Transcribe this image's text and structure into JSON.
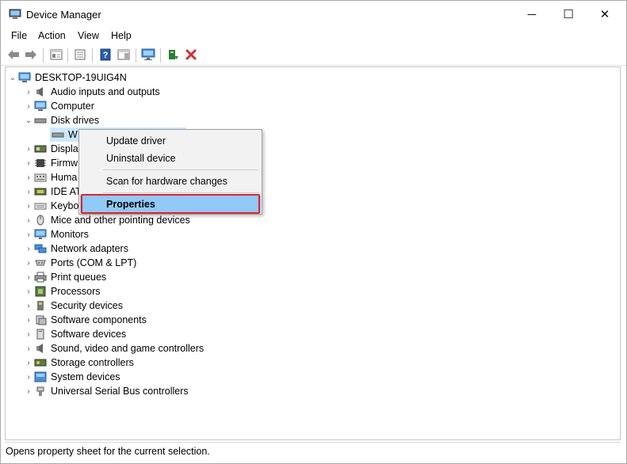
{
  "window": {
    "title": "Device Manager",
    "controls": {
      "minimize": "─",
      "maximize": "☐",
      "close": "✕"
    }
  },
  "menu": [
    "File",
    "Action",
    "View",
    "Help"
  ],
  "toolbar": {
    "buttons": [
      "back-icon",
      "forward-icon",
      "show-hide-tree-icon",
      "properties-icon",
      "help-icon",
      "action-pane-icon",
      "monitor-icon",
      "update-driver-icon",
      "uninstall-icon"
    ]
  },
  "tree": {
    "root": "DESKTOP-19UIG4N",
    "items": [
      {
        "label": "Audio inputs and outputs",
        "icon": "speaker-icon",
        "expanded": false
      },
      {
        "label": "Computer",
        "icon": "computer-icon",
        "expanded": false
      },
      {
        "label": "Disk drives",
        "icon": "disk-drive-icon",
        "expanded": true
      },
      {
        "label": "W",
        "icon": "disk-drive-icon",
        "child": true,
        "selected": true
      },
      {
        "label": "Displa",
        "icon": "display-adapter-icon",
        "expanded": false
      },
      {
        "label": "Firmw",
        "icon": "firmware-icon",
        "expanded": false
      },
      {
        "label": "Huma",
        "icon": "hid-icon",
        "expanded": false
      },
      {
        "label": "IDE AT",
        "icon": "ide-controller-icon",
        "expanded": false
      },
      {
        "label": "Keybo",
        "icon": "keyboard-icon",
        "expanded": false
      },
      {
        "label": "Mice and other pointing devices",
        "icon": "mouse-icon",
        "expanded": false
      },
      {
        "label": "Monitors",
        "icon": "monitor-icon",
        "expanded": false
      },
      {
        "label": "Network adapters",
        "icon": "network-icon",
        "expanded": false
      },
      {
        "label": "Ports (COM & LPT)",
        "icon": "port-icon",
        "expanded": false
      },
      {
        "label": "Print queues",
        "icon": "printer-icon",
        "expanded": false
      },
      {
        "label": "Processors",
        "icon": "processor-icon",
        "expanded": false
      },
      {
        "label": "Security devices",
        "icon": "security-icon",
        "expanded": false
      },
      {
        "label": "Software components",
        "icon": "software-component-icon",
        "expanded": false
      },
      {
        "label": "Software devices",
        "icon": "software-device-icon",
        "expanded": false
      },
      {
        "label": "Sound, video and game controllers",
        "icon": "speaker-icon",
        "expanded": false
      },
      {
        "label": "Storage controllers",
        "icon": "storage-controller-icon",
        "expanded": false
      },
      {
        "label": "System devices",
        "icon": "system-device-icon",
        "expanded": false
      },
      {
        "label": "Universal Serial Bus controllers",
        "icon": "usb-icon",
        "expanded": false
      }
    ]
  },
  "context_menu": {
    "update_driver": "Update driver",
    "uninstall_device": "Uninstall device",
    "scan": "Scan for hardware changes",
    "properties": "Properties",
    "highlight_color": "#e0252b",
    "hover_color": "#91c9f7"
  },
  "status": "Opens property sheet for the current selection."
}
